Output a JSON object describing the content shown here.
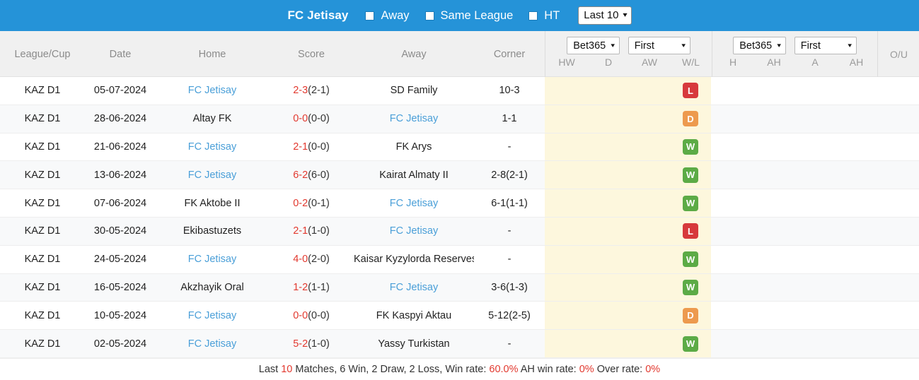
{
  "topbar": {
    "team": "FC Jetisay",
    "checkboxes": [
      {
        "label": "Away",
        "checked": false
      },
      {
        "label": "Same League",
        "checked": false
      },
      {
        "label": "HT",
        "checked": false
      }
    ],
    "range_select": {
      "value": "Last 10",
      "caret": "chevron-down-icon"
    }
  },
  "table": {
    "columns": [
      "League/Cup",
      "Date",
      "Home",
      "Score",
      "Away",
      "Corner"
    ],
    "odds_groups": [
      {
        "bookmaker": "Bet365",
        "period": "First",
        "subcolumns": [
          "HW",
          "D",
          "AW",
          "W/L"
        ]
      },
      {
        "bookmaker": "Bet365",
        "period": "First",
        "subcolumns": [
          "H",
          "AH",
          "A",
          "AH"
        ]
      }
    ],
    "ou_header": "O/U",
    "rows": [
      {
        "league": "KAZ D1",
        "date": "05-07-2024",
        "home": "FC Jetisay",
        "home_link": true,
        "score": "2-3",
        "ht": "(2-1)",
        "away": "SD Family",
        "away_link": false,
        "corner": "10-3",
        "result": "L"
      },
      {
        "league": "KAZ D1",
        "date": "28-06-2024",
        "home": "Altay FK",
        "home_link": false,
        "score": "0-0",
        "ht": "(0-0)",
        "away": "FC Jetisay",
        "away_link": true,
        "corner": "1-1",
        "result": "D"
      },
      {
        "league": "KAZ D1",
        "date": "21-06-2024",
        "home": "FC Jetisay",
        "home_link": true,
        "score": "2-1",
        "ht": "(0-0)",
        "away": "FK Arys",
        "away_link": false,
        "corner": "-",
        "result": "W"
      },
      {
        "league": "KAZ D1",
        "date": "13-06-2024",
        "home": "FC Jetisay",
        "home_link": true,
        "score": "6-2",
        "ht": "(6-0)",
        "away": "Kairat Almaty II",
        "away_link": false,
        "corner": "2-8(2-1)",
        "result": "W"
      },
      {
        "league": "KAZ D1",
        "date": "07-06-2024",
        "home": "FK Aktobe II",
        "home_link": false,
        "score": "0-2",
        "ht": "(0-1)",
        "away": "FC Jetisay",
        "away_link": true,
        "corner": "6-1(1-1)",
        "result": "W"
      },
      {
        "league": "KAZ D1",
        "date": "30-05-2024",
        "home": "Ekibastuzets",
        "home_link": false,
        "score": "2-1",
        "ht": "(1-0)",
        "away": "FC Jetisay",
        "away_link": true,
        "corner": "-",
        "result": "L"
      },
      {
        "league": "KAZ D1",
        "date": "24-05-2024",
        "home": "FC Jetisay",
        "home_link": true,
        "score": "4-0",
        "ht": "(2-0)",
        "away": "Kaisar Kyzylorda Reserves",
        "away_link": false,
        "corner": "-",
        "result": "W"
      },
      {
        "league": "KAZ D1",
        "date": "16-05-2024",
        "home": "Akzhayik Oral",
        "home_link": false,
        "score": "1-2",
        "ht": "(1-1)",
        "away": "FC Jetisay",
        "away_link": true,
        "corner": "3-6(1-3)",
        "result": "W"
      },
      {
        "league": "KAZ D1",
        "date": "10-05-2024",
        "home": "FC Jetisay",
        "home_link": true,
        "score": "0-0",
        "ht": "(0-0)",
        "away": "FK Kaspyi Aktau",
        "away_link": false,
        "corner": "5-12(2-5)",
        "result": "D"
      },
      {
        "league": "KAZ D1",
        "date": "02-05-2024",
        "home": "FC Jetisay",
        "home_link": true,
        "score": "5-2",
        "ht": "(1-0)",
        "away": "Yassy Turkistan",
        "away_link": false,
        "corner": "-",
        "result": "W"
      }
    ]
  },
  "footer": {
    "p1": "Last ",
    "count": "10",
    "p2": " Matches, 6 Win, 2 Draw, 2 Loss, Win rate: ",
    "winrate": "60.0%",
    "p3": " AH win rate: ",
    "ahrate": "0%",
    "p4": " Over rate: ",
    "overrate": "0%"
  },
  "colors": {
    "accent_blue": "#2593d8",
    "link_blue": "#4a9fd8",
    "score_red": "#e2392f",
    "win_green": "#5cab46",
    "draw_orange": "#ed9a4e",
    "loss_red": "#d7393c",
    "highlight_yellow": "#fdf7dd"
  }
}
